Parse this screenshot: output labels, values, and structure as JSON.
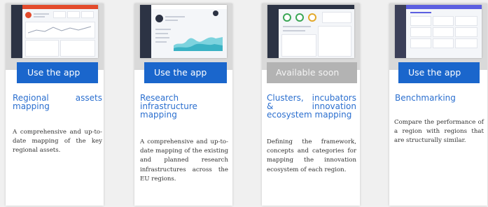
{
  "cards": [
    {
      "button_label": "Use the app",
      "button_state": "active",
      "title": "Regional assets mapping",
      "description": "A comprehensive and up-to-date mapping of the key regional assets."
    },
    {
      "button_label": "Use the app",
      "button_state": "active",
      "title": "Research infrastructure mapping",
      "description": "A comprehensive and up-to-date mapping of the existing and planned research infrastructures across the EU regions."
    },
    {
      "button_label": "Available soon",
      "button_state": "disabled",
      "title": "Clusters, incubators & innovation ecosystem mapping",
      "description": "Defining the framework, concepts and categories for mapping the innovation ecosystem of each region."
    },
    {
      "button_label": "Use the app",
      "button_state": "active",
      "title": "Benchmarking",
      "description": "Compare the performance of a region with regions that are structurally similar."
    }
  ],
  "colors": {
    "button_active": "#1a66cc",
    "button_disabled": "#b3b3b3",
    "title": "#2b6fcf"
  }
}
